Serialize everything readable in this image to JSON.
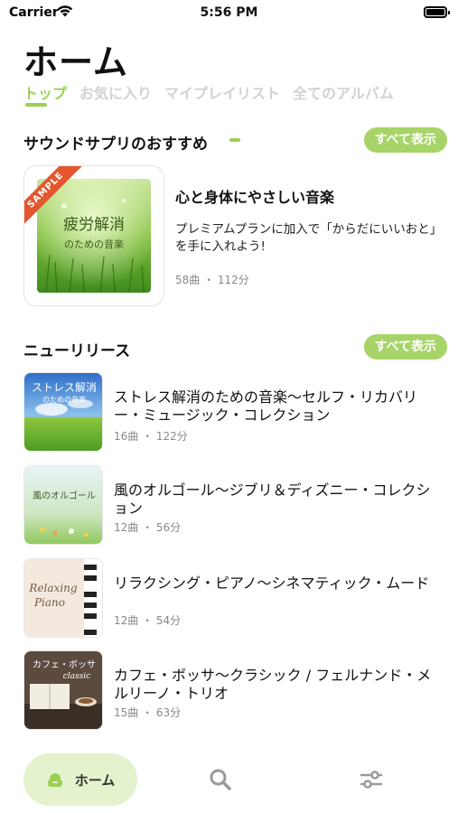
{
  "status_bar": {
    "carrier": "Carrier",
    "time": "5:56 PM"
  },
  "page": {
    "title": "ホーム"
  },
  "tabs": [
    {
      "label": "トップ",
      "active": true
    },
    {
      "label": "お気に入り",
      "active": false
    },
    {
      "label": "マイプレイリスト",
      "active": false
    },
    {
      "label": "全てのアルバム",
      "active": false
    }
  ],
  "recommended": {
    "title": "サウンドサプリのおすすめ",
    "see_all": "すべて表示",
    "featured": {
      "ribbon": "SAMPLE",
      "art_text_main": "疲労解消",
      "art_text_sub": "のための音楽",
      "title": "心と身体にやさしい音楽",
      "description": "プレミアムプランに加入で「からだにいいおと」を手に入れよう!",
      "meta": "58曲 ・ 112分"
    }
  },
  "new_releases": {
    "title": "ニューリリース",
    "see_all": "すべて表示",
    "items": [
      {
        "title": "ストレス解消のための音楽～セルフ・リカバリー・ミュージック・コレクション",
        "meta": "16曲 ・ 122分",
        "art_text": "ストレス解消",
        "art_sub": "のための音楽"
      },
      {
        "title": "風のオルゴール～ジブリ＆ディズニー・コレクション",
        "meta": "12曲 ・ 56分",
        "art_text": "風のオルゴール",
        "art_sub": ""
      },
      {
        "title": "リラクシング・ピアノ～シネマティック・ムード",
        "meta": "12曲 ・ 54分",
        "art_text": "Relaxing",
        "art_sub": "Piano"
      },
      {
        "title": "カフェ・ボッサ～クラシック / フェルナンド・メルリーノ・トリオ",
        "meta": "15曲 ・ 63分",
        "art_text": "カフェ・ボッサ",
        "art_sub": "classic"
      }
    ]
  },
  "tab_bar": {
    "home_label": "ホーム",
    "icons": [
      "home-icon",
      "search-icon",
      "settings-sliders-icon"
    ]
  },
  "colors": {
    "accent": "#9ccf55",
    "button": "#a7d468",
    "home_pill": "#e4f2cd",
    "ribbon": "#e4572e"
  }
}
